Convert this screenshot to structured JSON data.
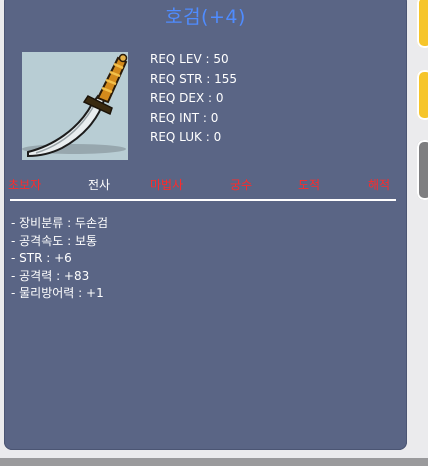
{
  "item": {
    "name": "호검(+4)",
    "icon": "sword-icon",
    "title_color": "#4f8cff",
    "background": "#5a6585"
  },
  "requirements": [
    "REQ LEV : 50",
    "REQ STR : 155",
    "REQ DEX : 0",
    "REQ INT : 0",
    "REQ LUK : 0"
  ],
  "jobs": [
    {
      "label": "초보자",
      "available": false
    },
    {
      "label": "전사",
      "available": true
    },
    {
      "label": "마법사",
      "available": false
    },
    {
      "label": "궁수",
      "available": false
    },
    {
      "label": "도적",
      "available": false
    },
    {
      "label": "해적",
      "available": false
    }
  ],
  "job_colors": {
    "available": "#ffffff",
    "unavailable": "#ff2a2a"
  },
  "stats": [
    "- 장비분류 : 두손검",
    "- 공격속도 : 보통",
    "- STR : +6",
    "- 공격력 : +83",
    "- 물리방어력 : +1"
  ]
}
